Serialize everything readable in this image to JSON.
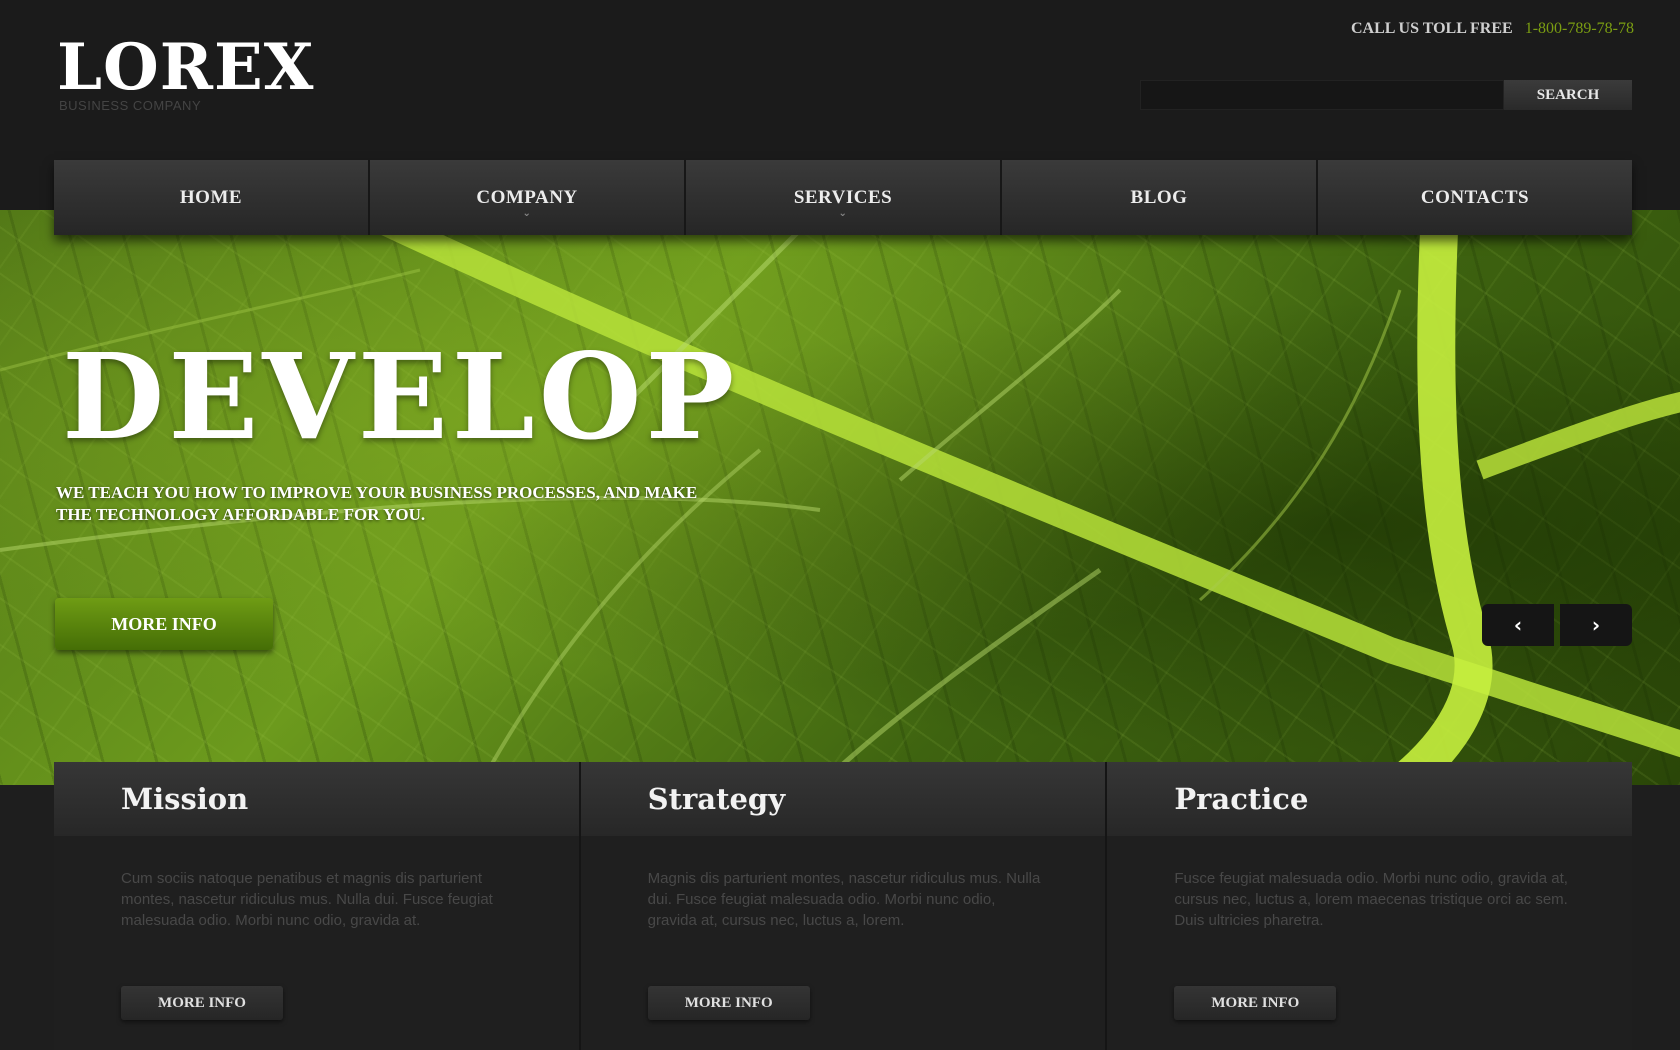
{
  "header": {
    "logo": "LOREX",
    "tagline": "BUSINESS COMPANY",
    "call_label": "CALL US TOLL FREE",
    "phone": "1-800-789-78-78",
    "search_placeholder": "",
    "search_button": "SEARCH"
  },
  "nav": {
    "items": [
      {
        "label": "HOME",
        "has_submenu": false
      },
      {
        "label": "COMPANY",
        "has_submenu": true
      },
      {
        "label": "SERVICES",
        "has_submenu": true
      },
      {
        "label": "BLOG",
        "has_submenu": false
      },
      {
        "label": "CONTACTS",
        "has_submenu": false
      }
    ],
    "chevron_glyph": "⌄"
  },
  "hero": {
    "title": "DEVELOP",
    "text": "WE TEACH YOU HOW TO IMPROVE YOUR BUSINESS PROCESSES, AND MAKE THE TECHNOLOGY AFFORDABLE FOR YOU.",
    "button": "MORE INFO",
    "prev_icon": "‹",
    "next_icon": "›",
    "background_image": "green-leaf-veins",
    "accent_color": "#5a8a10"
  },
  "columns": [
    {
      "title": "Mission",
      "text": "Cum sociis natoque penatibus et magnis dis parturient montes, nascetur ridiculus mus. Nulla dui. Fusce feugiat malesuada odio. Morbi nunc odio, gravida at.",
      "button": "MORE INFO"
    },
    {
      "title": "Strategy",
      "text": "Magnis dis parturient montes, nascetur ridiculus mus. Nulla dui. Fusce feugiat malesuada odio. Morbi nunc odio, gravida at, cursus nec, luctus a, lorem.",
      "button": "MORE INFO"
    },
    {
      "title": "Practice",
      "text": "Fusce feugiat malesuada odio. Morbi nunc odio, gravida at, cursus nec, luctus a, lorem maecenas tristique orci ac sem. Duis ultricies pharetra.",
      "button": "MORE INFO"
    }
  ]
}
